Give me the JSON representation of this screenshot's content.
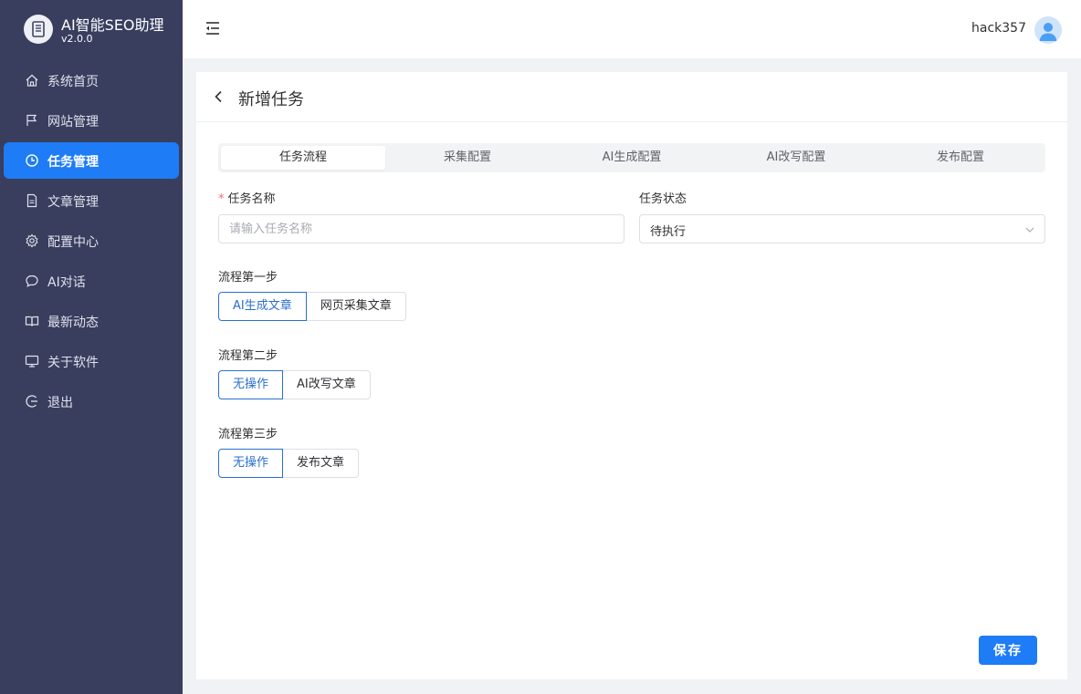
{
  "app": {
    "title": "AI智能SEO助理",
    "version": "v2.0.0"
  },
  "sidebar": {
    "items": [
      {
        "label": "系统首页",
        "icon": "home-icon",
        "active": false
      },
      {
        "label": "网站管理",
        "icon": "flag-icon",
        "active": false
      },
      {
        "label": "任务管理",
        "icon": "clock-icon",
        "active": true
      },
      {
        "label": "文章管理",
        "icon": "document-icon",
        "active": false
      },
      {
        "label": "配置中心",
        "icon": "gear-icon",
        "active": false
      },
      {
        "label": "AI对话",
        "icon": "chat-icon",
        "active": false
      },
      {
        "label": "最新动态",
        "icon": "book-icon",
        "active": false
      },
      {
        "label": "关于软件",
        "icon": "monitor-icon",
        "active": false
      },
      {
        "label": "退出",
        "icon": "logout-icon",
        "active": false
      }
    ]
  },
  "header": {
    "username": "hack357"
  },
  "page": {
    "title": "新增任务"
  },
  "tabs": [
    {
      "label": "任务流程",
      "active": true
    },
    {
      "label": "采集配置",
      "active": false
    },
    {
      "label": "AI生成配置",
      "active": false
    },
    {
      "label": "AI改写配置",
      "active": false
    },
    {
      "label": "发布配置",
      "active": false
    }
  ],
  "form": {
    "task_name": {
      "label": "任务名称",
      "required_mark": "*",
      "placeholder": "请输入任务名称",
      "value": ""
    },
    "task_status": {
      "label": "任务状态",
      "value": "待执行"
    },
    "step1": {
      "label": "流程第一步",
      "options": [
        "AI生成文章",
        "网页采集文章"
      ],
      "selected": "AI生成文章"
    },
    "step2": {
      "label": "流程第二步",
      "options": [
        "无操作",
        "AI改写文章"
      ],
      "selected": "无操作"
    },
    "step3": {
      "label": "流程第三步",
      "options": [
        "无操作",
        "发布文章"
      ],
      "selected": "无操作"
    }
  },
  "actions": {
    "save_label": "保存"
  },
  "colors": {
    "sidebar_bg": "#393e5f",
    "accent": "#1e7cf6",
    "selected_border": "#2a6fd0"
  }
}
